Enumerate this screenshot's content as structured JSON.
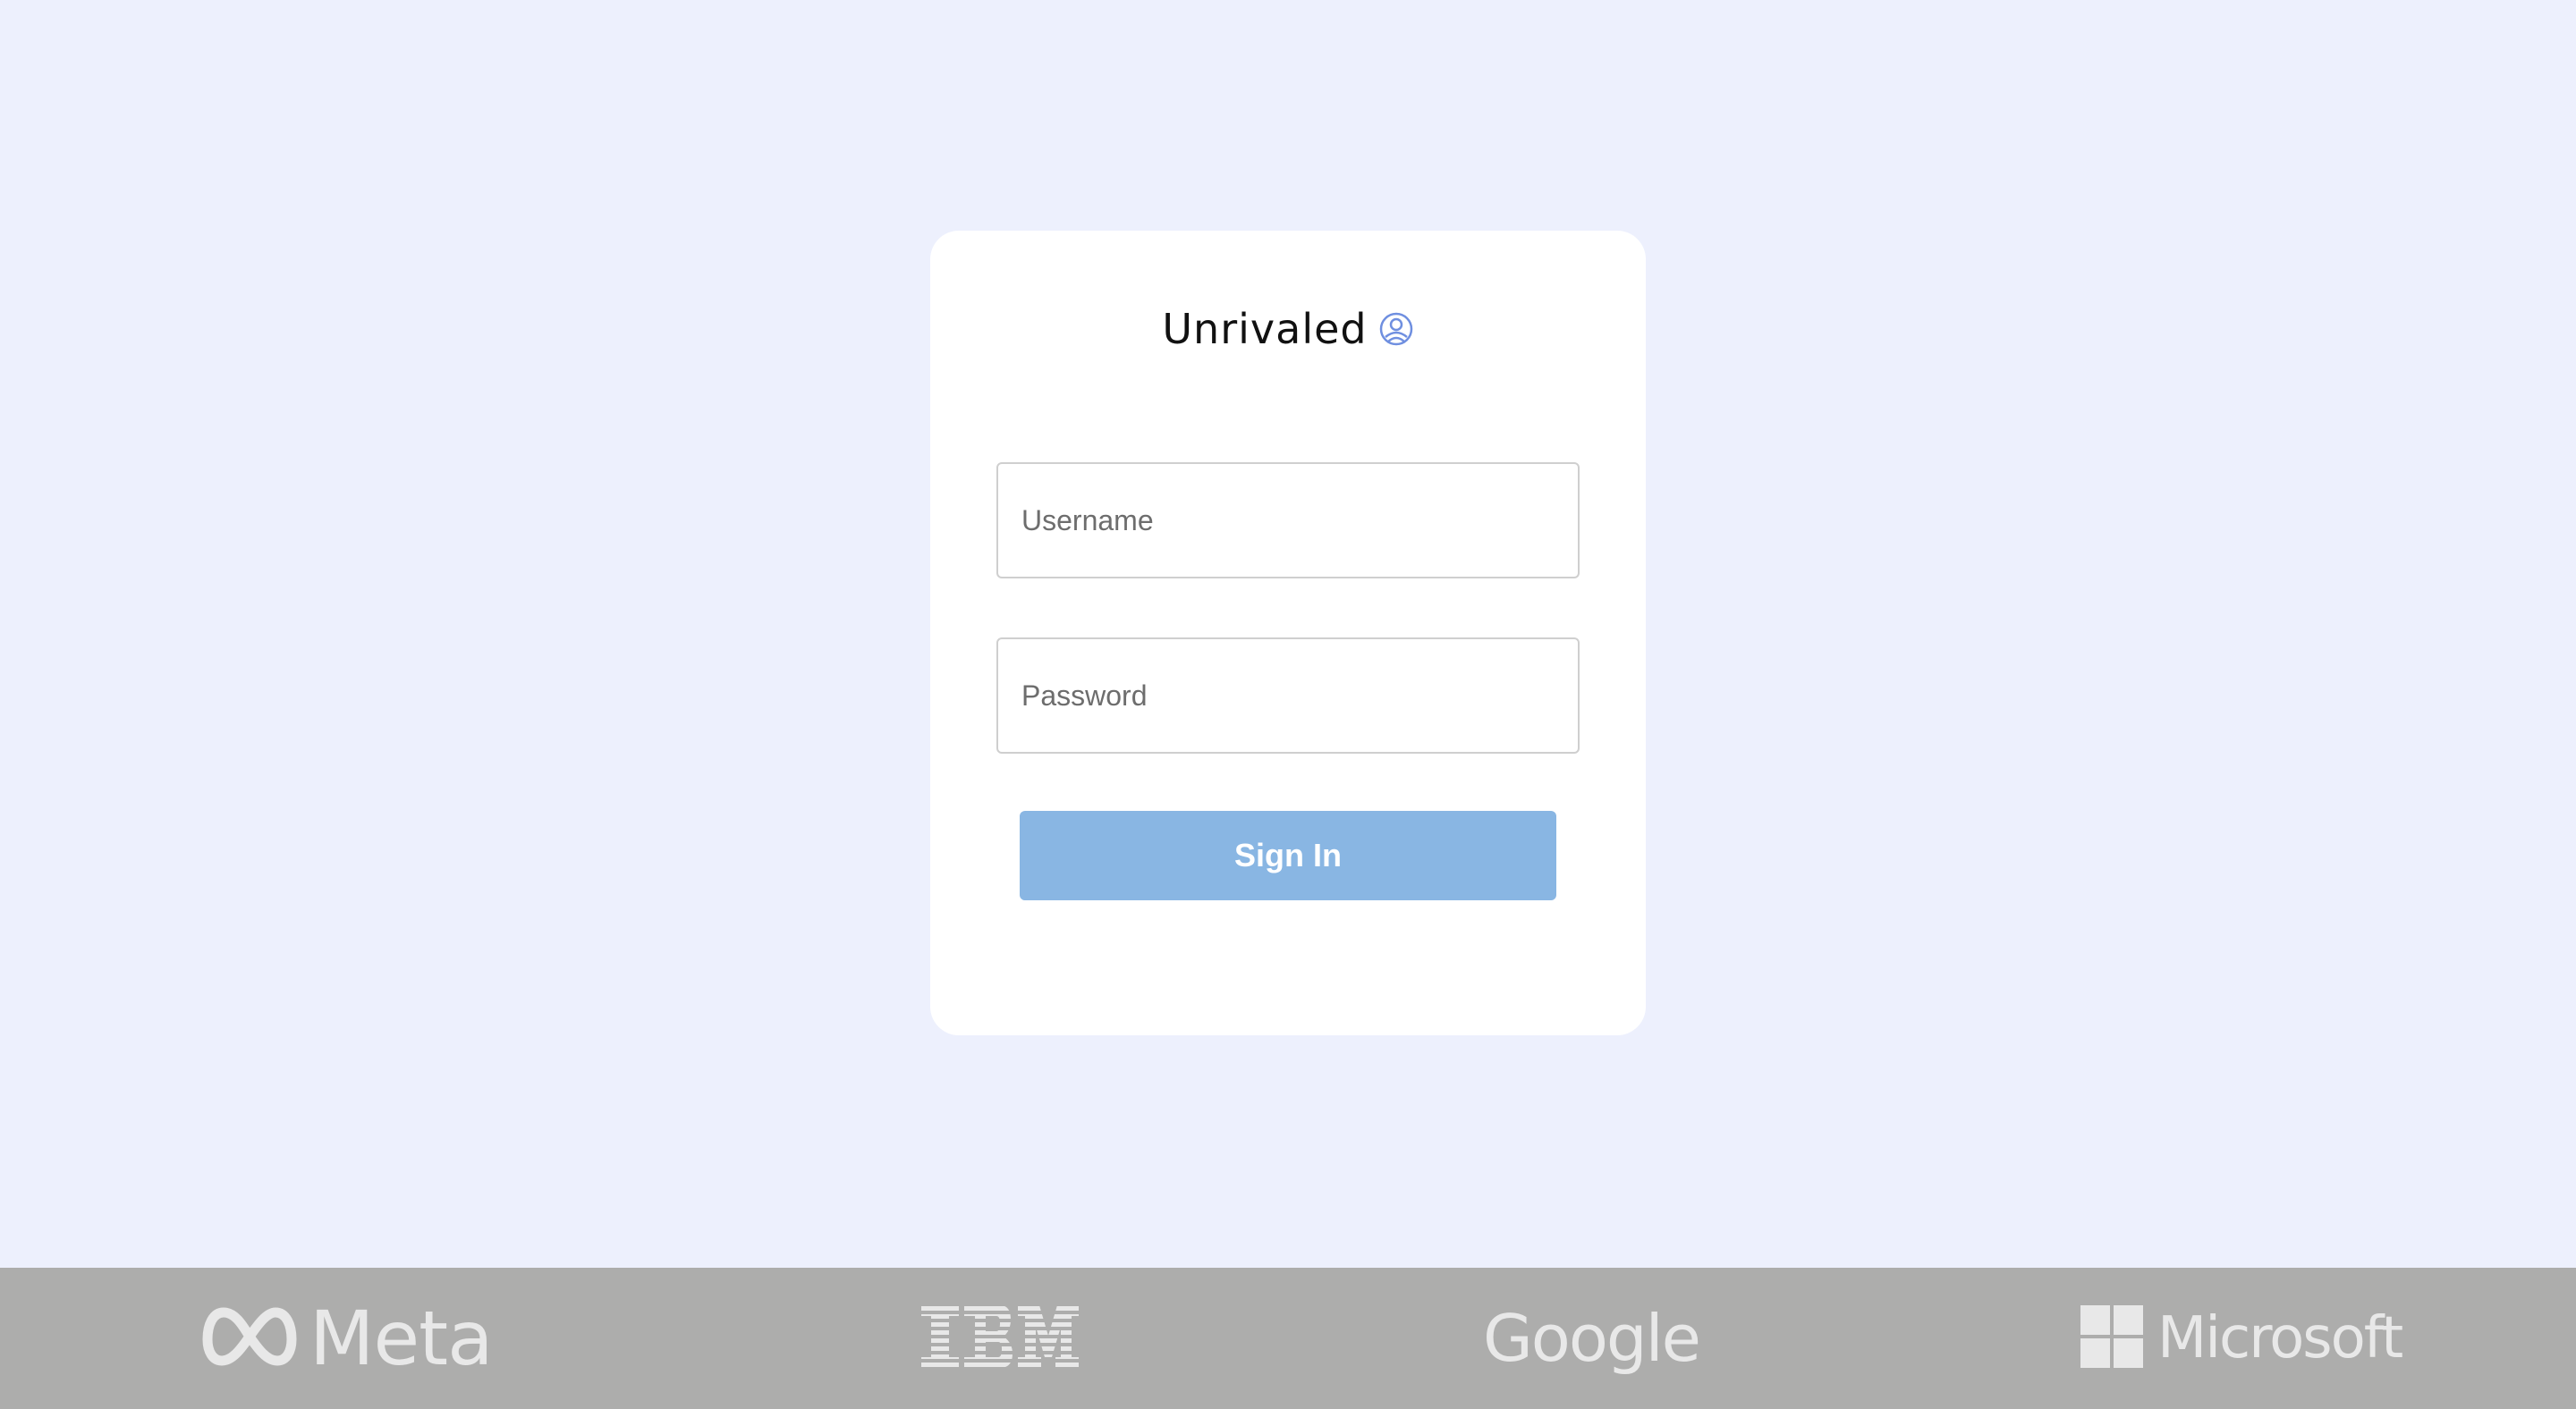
{
  "brand": {
    "name": "Unrivaled",
    "logo_icon": "unrivaled-logo-icon",
    "accent_color": "#6f8fe0"
  },
  "login_form": {
    "username_placeholder": "Username",
    "password_placeholder": "Password",
    "sign_in_label": "Sign In",
    "button_color": "#89b6e3"
  },
  "partners": [
    {
      "name": "Meta",
      "icon": "meta-infinity-icon"
    },
    {
      "name": "IBM",
      "icon": "ibm-striped-icon"
    },
    {
      "name": "Google",
      "icon": "google-wordmark"
    },
    {
      "name": "Microsoft",
      "icon": "microsoft-windows-icon"
    }
  ],
  "colors": {
    "page_background": "#edf0fd",
    "card_background": "#ffffff",
    "footer_background": "#adadac",
    "footer_logo": "#e8e8e8"
  }
}
